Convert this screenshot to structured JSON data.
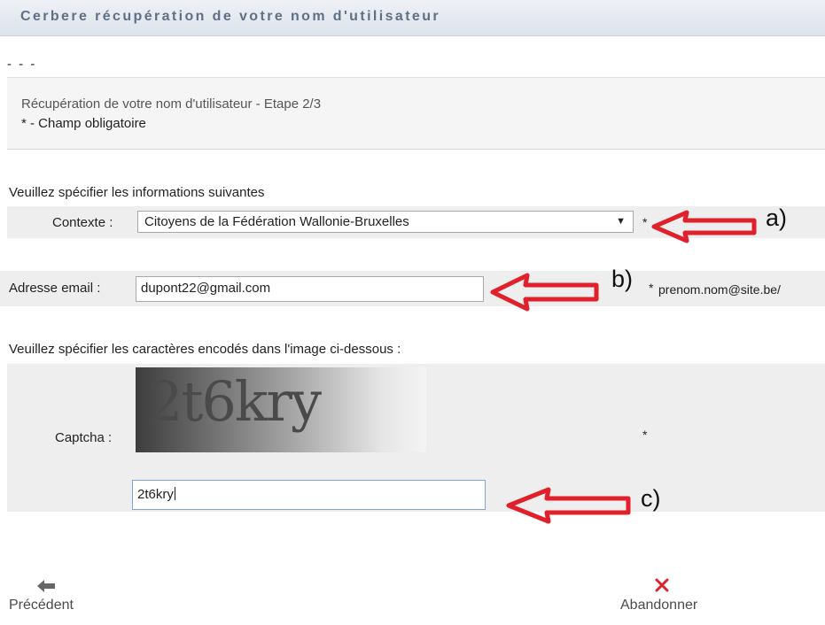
{
  "header": {
    "title": "Cerbere récupération de votre nom d'utilisateur"
  },
  "separator": "- - -",
  "step": {
    "title": "Récupération de votre nom d'utilisateur - Etape 2/3",
    "required_note": "* - Champ obligatoire"
  },
  "form": {
    "intro": "Veuillez spécifier les informations suivantes",
    "context": {
      "label": "Contexte :",
      "selected": "Citoyens de la Fédération Wallonie-Bruxelles",
      "required": "*"
    },
    "email": {
      "label": "Adresse email :",
      "value": "dupont22@gmail.com",
      "required": "*",
      "hint": "prenom.nom@site.be/"
    },
    "captcha": {
      "intro": "Veuillez spécifier les caractères encodés dans l'image ci-dessous :",
      "label": "Captcha :",
      "image_text": "2t6kry",
      "value": "2t6kry",
      "required": "*"
    }
  },
  "annotations": {
    "a": "a)",
    "b": "b)",
    "c": "c)"
  },
  "nav": {
    "previous": {
      "label": "Précédent",
      "icon": "arrow-left-icon"
    },
    "abandon": {
      "label": "Abandonner",
      "icon": "close-icon"
    }
  },
  "colors": {
    "annotation_arrow": "#e0202a",
    "abandon_icon": "#d9232d",
    "title_text": "#5f6f86"
  }
}
